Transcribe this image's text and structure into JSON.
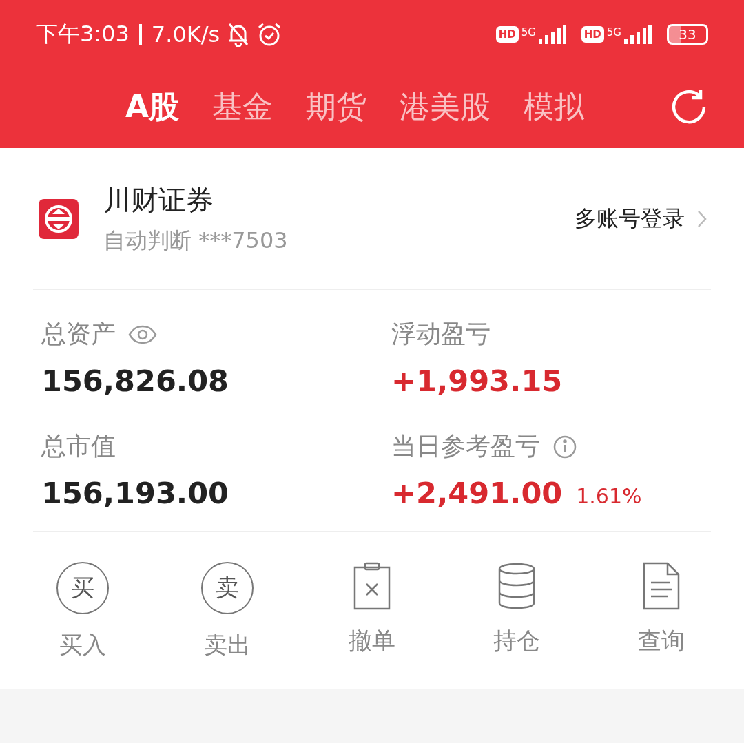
{
  "status_bar": {
    "time": "下午3:03",
    "speed": "7.0K/s",
    "sims": [
      {
        "badge": "HD",
        "network": "5G"
      },
      {
        "badge": "HD",
        "network": "5G"
      }
    ],
    "battery": "33"
  },
  "tabs": [
    {
      "label": "A股",
      "selected": true
    },
    {
      "label": "基金",
      "selected": false
    },
    {
      "label": "期货",
      "selected": false
    },
    {
      "label": "港美股",
      "selected": false
    },
    {
      "label": "模拟",
      "selected": false
    }
  ],
  "account": {
    "broker": "川财证券",
    "detail": "自动判断 ***7503",
    "link": "多账号登录"
  },
  "stats": [
    {
      "label": "总资产",
      "value": "156,826.08",
      "kind": "neutral"
    },
    {
      "label": "浮动盈亏",
      "value": "+1,993.15",
      "kind": "gain"
    },
    {
      "label": "总市值",
      "value": "156,193.00",
      "kind": "neutral"
    },
    {
      "label": "当日参考盈亏",
      "value": "+2,491.00",
      "percent": "1.61%",
      "kind": "gain"
    }
  ],
  "actions": [
    {
      "kind": "circle-char",
      "glyph": "买",
      "label": "买入"
    },
    {
      "kind": "circle-char",
      "glyph": "卖",
      "label": "卖出"
    },
    {
      "kind": "clipboard",
      "label": "撤单"
    },
    {
      "kind": "database",
      "label": "持仓"
    },
    {
      "kind": "document",
      "label": "查询"
    }
  ]
}
